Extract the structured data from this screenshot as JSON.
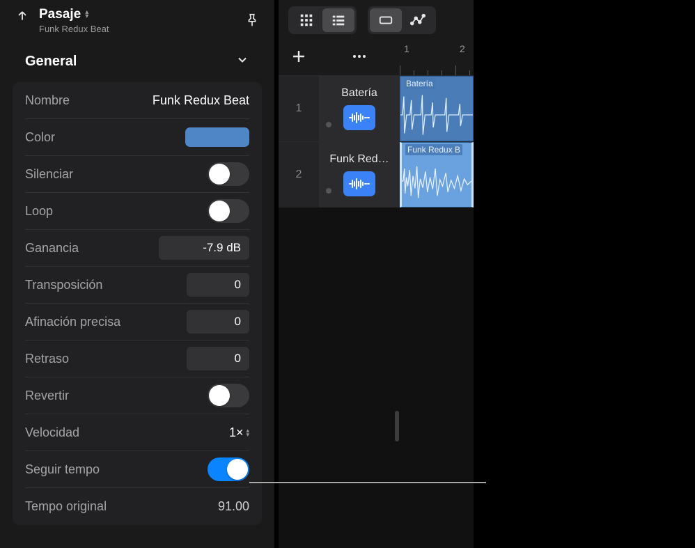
{
  "header": {
    "title": "Pasaje",
    "subtitle": "Funk Redux Beat"
  },
  "section": {
    "title": "General"
  },
  "props": {
    "name_label": "Nombre",
    "name_value": "Funk Redux Beat",
    "color_label": "Color",
    "color_value": "#4f86c6",
    "mute_label": "Silenciar",
    "loop_label": "Loop",
    "gain_label": "Ganancia",
    "gain_value": "-7.9 dB",
    "transpose_label": "Transposición",
    "transpose_value": "0",
    "finetune_label": "Afinación precisa",
    "finetune_value": "0",
    "delay_label": "Retraso",
    "delay_value": "0",
    "reverse_label": "Revertir",
    "speed_label": "Velocidad",
    "speed_value": "1×",
    "follow_tempo_label": "Seguir tempo",
    "orig_tempo_label": "Tempo original",
    "orig_tempo_value": "91.00"
  },
  "toggles": {
    "mute": false,
    "loop": false,
    "reverse": false,
    "follow_tempo": true
  },
  "ruler": {
    "n1": "1",
    "n2": "2"
  },
  "tracks": [
    {
      "num": "1",
      "name": "Batería",
      "region_label": "Batería",
      "selected": false
    },
    {
      "num": "2",
      "name": "Funk Red…",
      "region_label": "Funk Redux B",
      "selected": true
    }
  ]
}
